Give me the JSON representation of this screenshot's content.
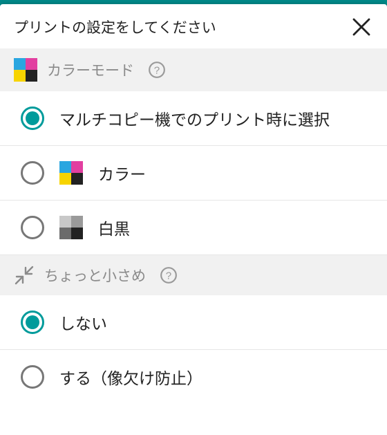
{
  "header": {
    "title": "プリントの設定をしてください"
  },
  "sections": {
    "color_mode": {
      "label": "カラーモード",
      "options": {
        "auto": {
          "label": "マルチコピー機でのプリント時に選択",
          "selected": true
        },
        "color": {
          "label": "カラー",
          "selected": false
        },
        "bw": {
          "label": "白黒",
          "selected": false
        }
      }
    },
    "shrink": {
      "label": "ちょっと小さめ",
      "options": {
        "off": {
          "label": "しない",
          "selected": true
        },
        "on": {
          "label": "する（像欠け防止）",
          "selected": false
        }
      }
    }
  }
}
